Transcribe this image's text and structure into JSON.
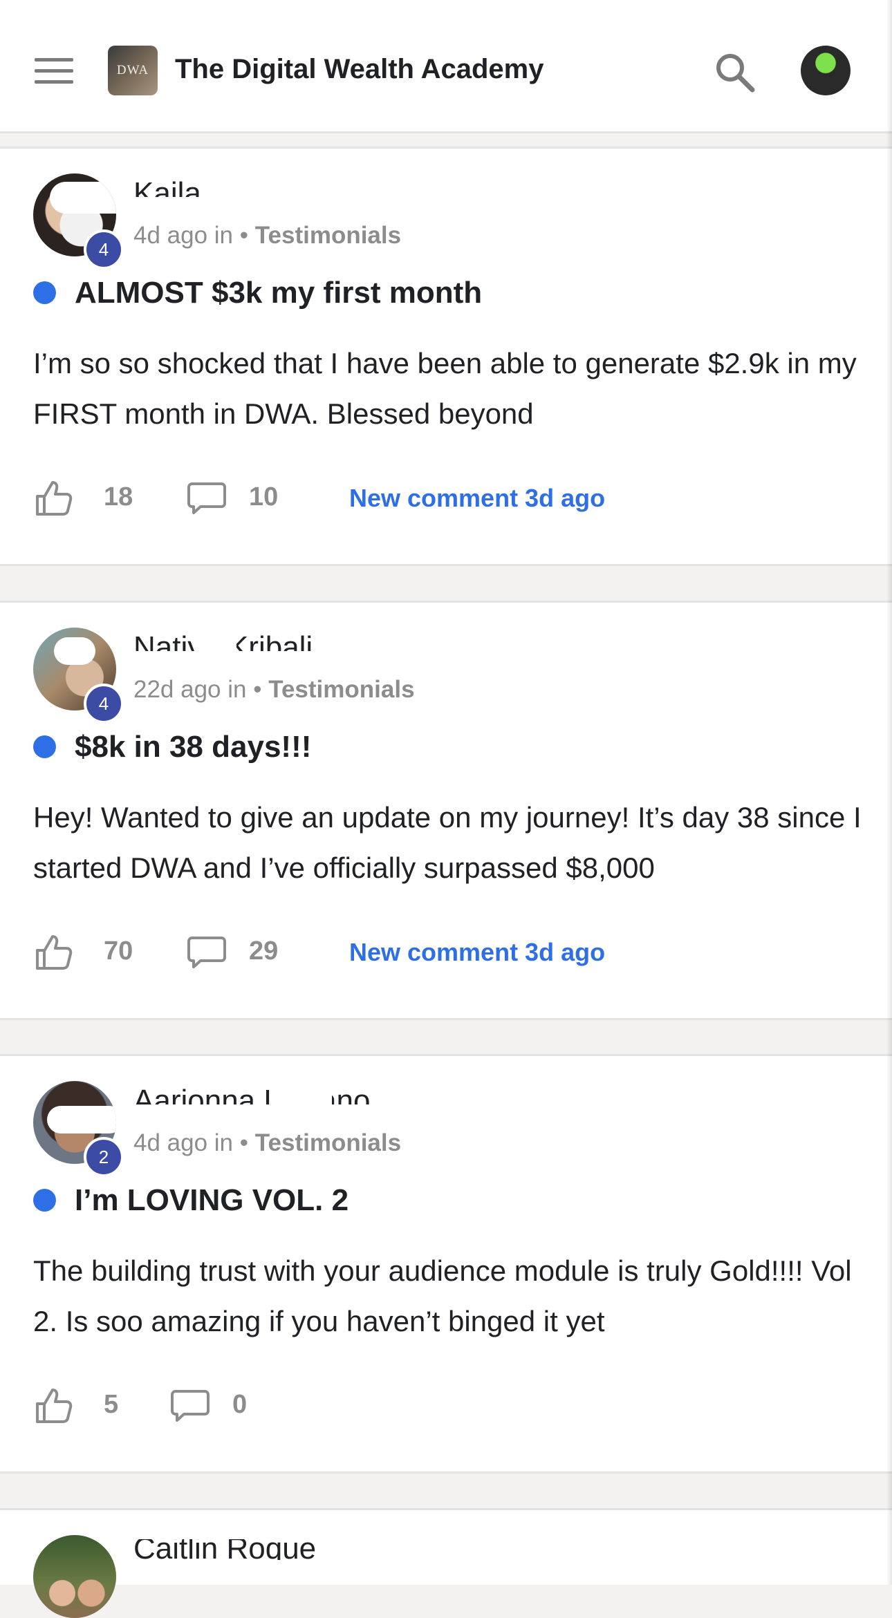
{
  "header": {
    "app_title": "The Digital Wealth Academy",
    "logo_text": "DWA",
    "menu_icon": "hamburger-menu-icon",
    "search_icon": "search-icon"
  },
  "posts": [
    {
      "author": "Kaila Lugo",
      "level": "4",
      "time": "4d ago in",
      "category": "Testimonials",
      "title": "ALMOST $3k my first month",
      "body": "I’m so so shocked that I have been able to generate $2.9k in my FIRST month in DWA. Blessed beyond",
      "likes": "18",
      "comments": "10",
      "new_comment": "New comment 3d ago"
    },
    {
      "author": "Natiya Kribali",
      "level": "4",
      "time": "22d ago in",
      "category": "Testimonials",
      "title": "$8k in 38 days!!!",
      "body": "Hey! Wanted to give an update on my journey! It’s day 38 since I started DWA and I’ve officially surpassed $8,000",
      "likes": "70",
      "comments": "29",
      "new_comment": "New comment 3d ago"
    },
    {
      "author": "Aarionna Luciano",
      "level": "2",
      "time": "4d ago in",
      "category": "Testimonials",
      "title": "I’m LOVING VOL. 2",
      "body": "The building trust with your audience module is truly Gold!!!! Vol 2. Is soo amazing if you haven’t binged it yet",
      "likes": "5",
      "comments": "0",
      "new_comment": ""
    },
    {
      "author": "Caitlin Roque"
    }
  ],
  "colors": {
    "accent": "#2f6fe6",
    "badge": "#3c4ba4",
    "muted": "#8c8c8c"
  }
}
